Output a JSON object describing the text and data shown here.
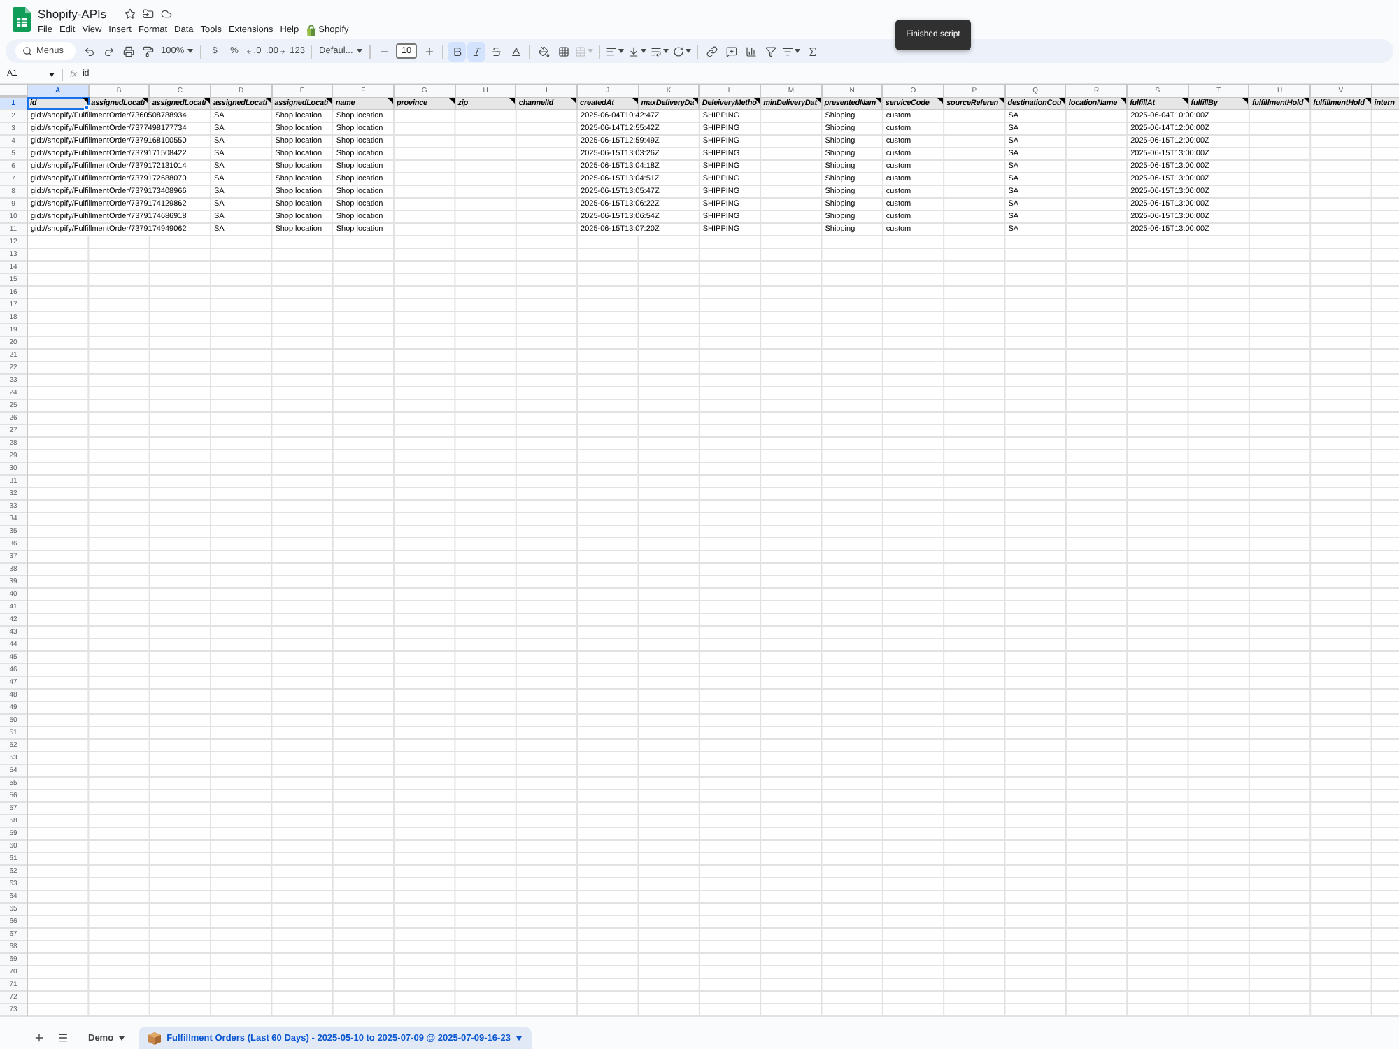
{
  "document": {
    "title": "Shopify-APIs"
  },
  "menu": [
    {
      "label": "File",
      "kind": "menu"
    },
    {
      "label": "Edit",
      "kind": "menu"
    },
    {
      "label": "View",
      "kind": "menu"
    },
    {
      "label": "Insert",
      "kind": "menu"
    },
    {
      "label": "Format",
      "kind": "menu"
    },
    {
      "label": "Data",
      "kind": "menu"
    },
    {
      "label": "Tools",
      "kind": "menu"
    },
    {
      "label": "Extensions",
      "kind": "menu"
    },
    {
      "label": "Help",
      "kind": "menu"
    },
    {
      "label": "Shopify",
      "kind": "addon"
    }
  ],
  "toast": {
    "message": "Finished script"
  },
  "toolbar": {
    "search": {
      "placeholder": "Menus"
    },
    "zoom": "100%",
    "currency": "$",
    "percent": "%",
    "decrease_decimals": ".0",
    "increase_decimals": ".00",
    "number_format": "123",
    "font": "Defaul...",
    "font_size": "10",
    "bold": {
      "selected": true
    },
    "italic": {
      "selected": true
    },
    "merge": {
      "disabled": true
    }
  },
  "formula_bar": {
    "cell": "A1",
    "function_label": "fx",
    "value": "id"
  },
  "sheet": {
    "columns": [
      {
        "letter": "A",
        "selected": true
      },
      {
        "letter": "B",
        "selected": false
      },
      {
        "letter": "C",
        "selected": false
      },
      {
        "letter": "D",
        "selected": false
      },
      {
        "letter": "E",
        "selected": false
      },
      {
        "letter": "F",
        "selected": false
      },
      {
        "letter": "G",
        "selected": false
      },
      {
        "letter": "H",
        "selected": false
      },
      {
        "letter": "I",
        "selected": false
      },
      {
        "letter": "J",
        "selected": false
      },
      {
        "letter": "K",
        "selected": false
      },
      {
        "letter": "L",
        "selected": false
      },
      {
        "letter": "M",
        "selected": false
      },
      {
        "letter": "N",
        "selected": false
      },
      {
        "letter": "O",
        "selected": false
      },
      {
        "letter": "P",
        "selected": false
      },
      {
        "letter": "Q",
        "selected": false
      },
      {
        "letter": "R",
        "selected": false
      },
      {
        "letter": "S",
        "selected": false
      },
      {
        "letter": "T",
        "selected": false
      },
      {
        "letter": "U",
        "selected": false
      },
      {
        "letter": "V",
        "selected": false
      },
      {
        "selected": false
      }
    ],
    "rows": [
      {
        "number": "1",
        "selected": true,
        "kind": "header",
        "cells": [
          {
            "text": "id",
            "note": true
          },
          {
            "text": "assignedLocati",
            "note": true
          },
          {
            "text": "assignedLocati",
            "note": true
          },
          {
            "text": "assignedLocati",
            "note": true
          },
          {
            "text": "assignedLocati",
            "note": true
          },
          {
            "text": "name",
            "note": true
          },
          {
            "text": "province",
            "note": true
          },
          {
            "text": "zip",
            "note": true
          },
          {
            "text": "channelId",
            "note": true
          },
          {
            "text": "createdAt",
            "note": true
          },
          {
            "text": "maxDeliveryDa",
            "note": true
          },
          {
            "text": "DeleiveryMetho",
            "note": true
          },
          {
            "text": "minDeliveryDat",
            "note": true
          },
          {
            "text": "presentedNam",
            "note": true
          },
          {
            "text": "serviceCode",
            "note": true
          },
          {
            "text": "sourceReferen",
            "note": true
          },
          {
            "text": "destinationCou",
            "note": true
          },
          {
            "text": "locationName",
            "note": true
          },
          {
            "text": "fulfillAt",
            "note": true
          },
          {
            "text": "fulfillBy",
            "note": true
          },
          {
            "text": "fulfillmentHold",
            "note": true
          },
          {
            "text": "fulfillmentHold",
            "note": true
          },
          {
            "text": "intern"
          }
        ]
      },
      {
        "number": "2",
        "selected": false,
        "kind": "data",
        "cells": [
          "gid://shopify/FulfillmentOrder/7360508788934",
          null,
          null,
          "SA",
          "Shop location",
          "Shop location",
          null,
          null,
          null,
          "2025-06-04T10:42:47Z",
          null,
          "SHIPPING",
          null,
          "Shipping",
          "custom",
          null,
          "SA",
          null,
          "2025-06-04T10:00:00Z"
        ]
      },
      {
        "number": "3",
        "selected": false,
        "kind": "data",
        "cells": [
          "gid://shopify/FulfillmentOrder/7377498177734",
          null,
          null,
          "SA",
          "Shop location",
          "Shop location",
          null,
          null,
          null,
          "2025-06-14T12:55:42Z",
          null,
          "SHIPPING",
          null,
          "Shipping",
          "custom",
          null,
          "SA",
          null,
          "2025-06-14T12:00:00Z"
        ]
      },
      {
        "number": "4",
        "selected": false,
        "kind": "data",
        "cells": [
          "gid://shopify/FulfillmentOrder/7379168100550",
          null,
          null,
          "SA",
          "Shop location",
          "Shop location",
          null,
          null,
          null,
          "2025-06-15T12:59:49Z",
          null,
          "SHIPPING",
          null,
          "Shipping",
          "custom",
          null,
          "SA",
          null,
          "2025-06-15T12:00:00Z"
        ]
      },
      {
        "number": "5",
        "selected": false,
        "kind": "data",
        "cells": [
          "gid://shopify/FulfillmentOrder/7379171508422",
          null,
          null,
          "SA",
          "Shop location",
          "Shop location",
          null,
          null,
          null,
          "2025-06-15T13:03:26Z",
          null,
          "SHIPPING",
          null,
          "Shipping",
          "custom",
          null,
          "SA",
          null,
          "2025-06-15T13:00:00Z"
        ]
      },
      {
        "number": "6",
        "selected": false,
        "kind": "data",
        "cells": [
          "gid://shopify/FulfillmentOrder/7379172131014",
          null,
          null,
          "SA",
          "Shop location",
          "Shop location",
          null,
          null,
          null,
          "2025-06-15T13:04:18Z",
          null,
          "SHIPPING",
          null,
          "Shipping",
          "custom",
          null,
          "SA",
          null,
          "2025-06-15T13:00:00Z"
        ]
      },
      {
        "number": "7",
        "selected": false,
        "kind": "data",
        "cells": [
          "gid://shopify/FulfillmentOrder/7379172688070",
          null,
          null,
          "SA",
          "Shop location",
          "Shop location",
          null,
          null,
          null,
          "2025-06-15T13:04:51Z",
          null,
          "SHIPPING",
          null,
          "Shipping",
          "custom",
          null,
          "SA",
          null,
          "2025-06-15T13:00:00Z"
        ]
      },
      {
        "number": "8",
        "selected": false,
        "kind": "data",
        "cells": [
          "gid://shopify/FulfillmentOrder/7379173408966",
          null,
          null,
          "SA",
          "Shop location",
          "Shop location",
          null,
          null,
          null,
          "2025-06-15T13:05:47Z",
          null,
          "SHIPPING",
          null,
          "Shipping",
          "custom",
          null,
          "SA",
          null,
          "2025-06-15T13:00:00Z"
        ]
      },
      {
        "number": "9",
        "selected": false,
        "kind": "data",
        "cells": [
          "gid://shopify/FulfillmentOrder/7379174129862",
          null,
          null,
          "SA",
          "Shop location",
          "Shop location",
          null,
          null,
          null,
          "2025-06-15T13:06:22Z",
          null,
          "SHIPPING",
          null,
          "Shipping",
          "custom",
          null,
          "SA",
          null,
          "2025-06-15T13:00:00Z"
        ]
      },
      {
        "number": "10",
        "selected": false,
        "kind": "data",
        "cells": [
          "gid://shopify/FulfillmentOrder/7379174686918",
          null,
          null,
          "SA",
          "Shop location",
          "Shop location",
          null,
          null,
          null,
          "2025-06-15T13:06:54Z",
          null,
          "SHIPPING",
          null,
          "Shipping",
          "custom",
          null,
          "SA",
          null,
          "2025-06-15T13:00:00Z"
        ]
      },
      {
        "number": "11",
        "selected": false,
        "kind": "data",
        "cells": [
          "gid://shopify/FulfillmentOrder/7379174949062",
          null,
          null,
          "SA",
          "Shop location",
          "Shop location",
          null,
          null,
          null,
          "2025-06-15T13:07:20Z",
          null,
          "SHIPPING",
          null,
          "Shipping",
          "custom",
          null,
          "SA",
          null,
          "2025-06-15T13:00:00Z"
        ]
      },
      {
        "number": "12",
        "selected": false,
        "kind": "data"
      },
      {
        "number": "13",
        "selected": false,
        "kind": "data"
      },
      {
        "number": "14",
        "selected": false,
        "kind": "data"
      },
      {
        "number": "15",
        "selected": false,
        "kind": "data"
      },
      {
        "number": "16",
        "selected": false,
        "kind": "data"
      },
      {
        "number": "17",
        "selected": false,
        "kind": "data"
      },
      {
        "number": "18",
        "selected": false,
        "kind": "data"
      },
      {
        "number": "19",
        "selected": false,
        "kind": "data"
      },
      {
        "number": "20",
        "selected": false,
        "kind": "data"
      },
      {
        "number": "21",
        "selected": false,
        "kind": "data"
      },
      {
        "number": "22",
        "selected": false,
        "kind": "data"
      },
      {
        "number": "23",
        "selected": false,
        "kind": "data"
      },
      {
        "number": "24",
        "selected": false,
        "kind": "data"
      },
      {
        "number": "25",
        "selected": false,
        "kind": "data"
      },
      {
        "number": "26",
        "selected": false,
        "kind": "data"
      },
      {
        "number": "27",
        "selected": false,
        "kind": "data"
      },
      {
        "number": "28",
        "selected": false,
        "kind": "data"
      },
      {
        "number": "29",
        "selected": false,
        "kind": "data"
      },
      {
        "number": "30",
        "selected": false,
        "kind": "data"
      },
      {
        "number": "31",
        "selected": false,
        "kind": "data"
      },
      {
        "number": "32",
        "selected": false,
        "kind": "data"
      },
      {
        "number": "33",
        "selected": false,
        "kind": "data"
      },
      {
        "number": "34",
        "selected": false,
        "kind": "data"
      },
      {
        "number": "35",
        "selected": false,
        "kind": "data"
      },
      {
        "number": "36",
        "selected": false,
        "kind": "data"
      },
      {
        "number": "37",
        "selected": false,
        "kind": "data"
      },
      {
        "number": "38",
        "selected": false,
        "kind": "data"
      },
      {
        "number": "39",
        "selected": false,
        "kind": "data"
      },
      {
        "number": "40",
        "selected": false,
        "kind": "data"
      },
      {
        "number": "41",
        "selected": false,
        "kind": "data"
      },
      {
        "number": "42",
        "selected": false,
        "kind": "data"
      },
      {
        "number": "43",
        "selected": false,
        "kind": "data"
      },
      {
        "number": "44",
        "selected": false,
        "kind": "data"
      },
      {
        "number": "45",
        "selected": false,
        "kind": "data"
      },
      {
        "number": "46",
        "selected": false,
        "kind": "data"
      },
      {
        "number": "47",
        "selected": false,
        "kind": "data"
      },
      {
        "number": "48",
        "selected": false,
        "kind": "data"
      },
      {
        "number": "49",
        "selected": false,
        "kind": "data"
      },
      {
        "number": "50",
        "selected": false,
        "kind": "data"
      },
      {
        "number": "51",
        "selected": false,
        "kind": "data"
      },
      {
        "number": "52",
        "selected": false,
        "kind": "data"
      },
      {
        "number": "53",
        "selected": false,
        "kind": "data"
      },
      {
        "number": "54",
        "selected": false,
        "kind": "data"
      },
      {
        "number": "55",
        "selected": false,
        "kind": "data"
      },
      {
        "number": "56",
        "selected": false,
        "kind": "data"
      },
      {
        "number": "57",
        "selected": false,
        "kind": "data"
      },
      {
        "number": "58",
        "selected": false,
        "kind": "data"
      },
      {
        "number": "59",
        "selected": false,
        "kind": "data"
      },
      {
        "number": "60",
        "selected": false,
        "kind": "data"
      },
      {
        "number": "61",
        "selected": false,
        "kind": "data"
      },
      {
        "number": "62",
        "selected": false,
        "kind": "data"
      },
      {
        "number": "63",
        "selected": false,
        "kind": "data"
      },
      {
        "number": "64",
        "selected": false,
        "kind": "data"
      },
      {
        "number": "65",
        "selected": false,
        "kind": "data"
      },
      {
        "number": "66",
        "selected": false,
        "kind": "data"
      },
      {
        "number": "67",
        "selected": false,
        "kind": "data"
      },
      {
        "number": "68",
        "selected": false,
        "kind": "data"
      },
      {
        "number": "69",
        "selected": false,
        "kind": "data"
      },
      {
        "number": "70",
        "selected": false,
        "kind": "data"
      },
      {
        "number": "71",
        "selected": false,
        "kind": "data"
      },
      {
        "number": "72",
        "selected": false,
        "kind": "data"
      },
      {
        "number": "73",
        "selected": false,
        "kind": "data"
      }
    ]
  },
  "sheet_tabs": [
    {
      "label": "Demo",
      "selected": false,
      "kind": "plain"
    },
    {
      "label": "Fulfillment Orders (Last 60 Days) - 2025-05-10 to 2025-07-09 @ 2025-07-09-16-23",
      "selected": true,
      "kind": "icon"
    }
  ]
}
